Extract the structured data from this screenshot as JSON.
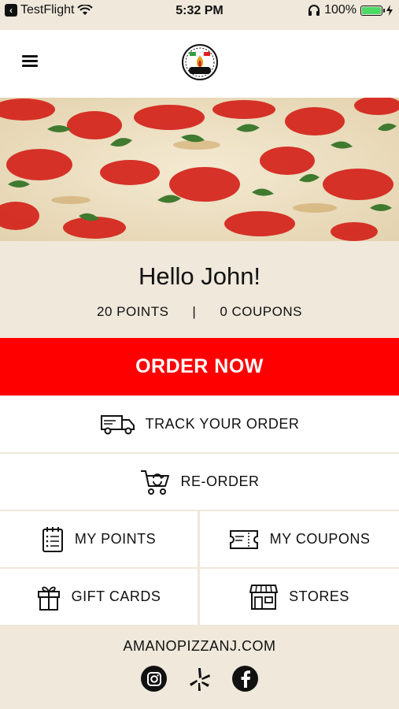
{
  "status_bar": {
    "back_app": "TestFlight",
    "time": "5:32 PM",
    "battery": "100%",
    "battery_level": 1.0
  },
  "greeting": {
    "title": "Hello John!",
    "points": "20 POINTS",
    "separator": "|",
    "coupons": "0 COUPONS"
  },
  "actions": {
    "order_now": "ORDER NOW",
    "track_order": "TRACK YOUR ORDER",
    "reorder": "RE-ORDER",
    "my_points": "MY POINTS",
    "my_coupons": "MY COUPONS",
    "gift_cards": "GIFT CARDS",
    "stores": "STORES"
  },
  "footer": {
    "website": "AMANOPIZZANJ.COM",
    "social_icons": [
      "instagram-icon",
      "yelp-icon",
      "facebook-icon"
    ]
  },
  "colors": {
    "accent_red": "#ff0000",
    "background_beige": "#efe8db",
    "battery_green": "#4cd964"
  }
}
